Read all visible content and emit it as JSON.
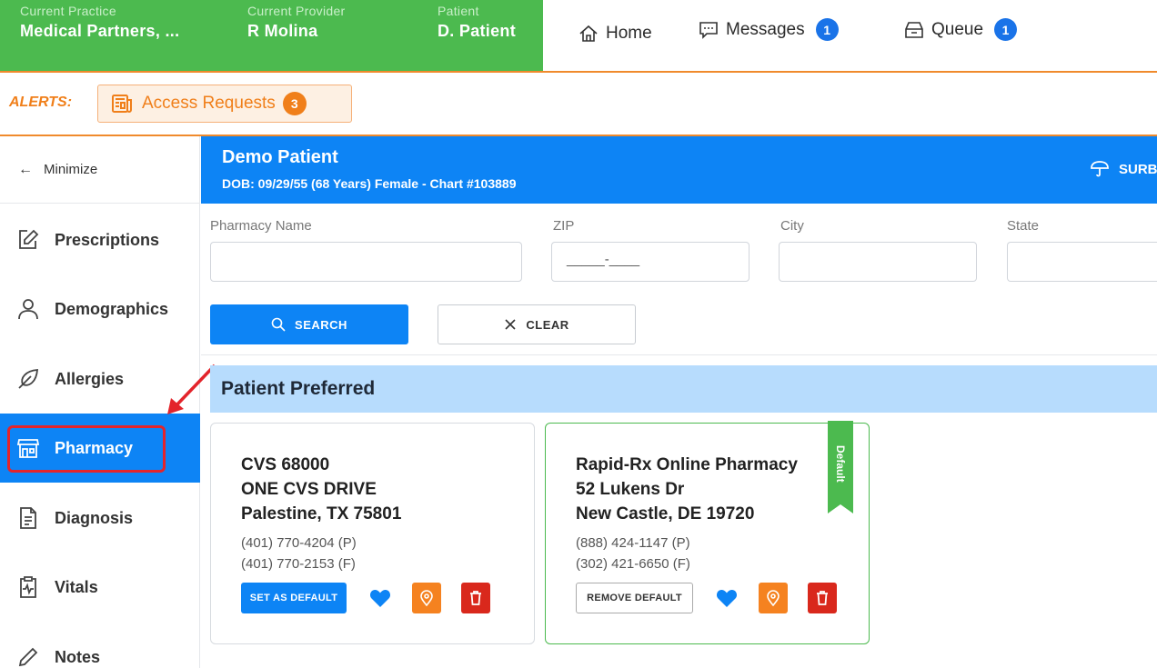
{
  "context": {
    "practice_label": "Current Practice",
    "practice_value": "Medical Partners, ...",
    "provider_label": "Current Provider",
    "provider_value": "R Molina",
    "patient_label": "Patient",
    "patient_value": "D. Patient"
  },
  "nav": {
    "home_label": "Home",
    "messages_label": "Messages",
    "messages_count": "1",
    "queue_label": "Queue",
    "queue_count": "1"
  },
  "alerts": {
    "label": "ALERTS:",
    "access_requests_label": "Access Requests",
    "access_requests_count": "3"
  },
  "sidebar": {
    "minimize_label": "Minimize",
    "items": [
      {
        "label": "Prescriptions",
        "icon": "edit-icon"
      },
      {
        "label": "Demographics",
        "icon": "person-icon"
      },
      {
        "label": "Allergies",
        "icon": "feather-icon"
      },
      {
        "label": "Pharmacy",
        "icon": "store-icon",
        "active": true
      },
      {
        "label": "Diagnosis",
        "icon": "document-icon"
      },
      {
        "label": "Vitals",
        "icon": "clipboard-pulse-icon"
      },
      {
        "label": "Notes",
        "icon": "pencil-icon"
      }
    ]
  },
  "patient_header": {
    "name": "Demo Patient",
    "details": "DOB: 09/29/55 (68 Years) Female - Chart #103889",
    "right_action": "SURB"
  },
  "search_form": {
    "pharmacy_name_label": "Pharmacy Name",
    "pharmacy_name_value": "",
    "zip_label": "ZIP",
    "zip_value": "_____-____",
    "city_label": "City",
    "city_value": "",
    "state_label": "State",
    "state_value": "",
    "search_button": "SEARCH",
    "clear_button": "CLEAR"
  },
  "section_title": "Patient Preferred",
  "pharmacies": [
    {
      "name": "CVS 68000",
      "address1": "ONE CVS DRIVE",
      "address2": "Palestine, TX 75801",
      "phone": "(401) 770-4204 (P)",
      "fax": "(401) 770-2153 (F)",
      "default_action": "SET AS DEFAULT"
    },
    {
      "name": "Rapid-Rx Online Pharmacy",
      "address1": "52 Lukens Dr",
      "address2": "New Castle, DE 19720",
      "phone": "(888) 424-1147 (P)",
      "fax": "(302) 421-6650 (F)",
      "default_action": "REMOVE DEFAULT",
      "ribbon": "Default"
    }
  ],
  "colors": {
    "green": "#4cba4f",
    "blue": "#0d84f5",
    "orange": "#f07f1a",
    "red": "#d9281c",
    "light_blue": "#b7dcfd"
  }
}
